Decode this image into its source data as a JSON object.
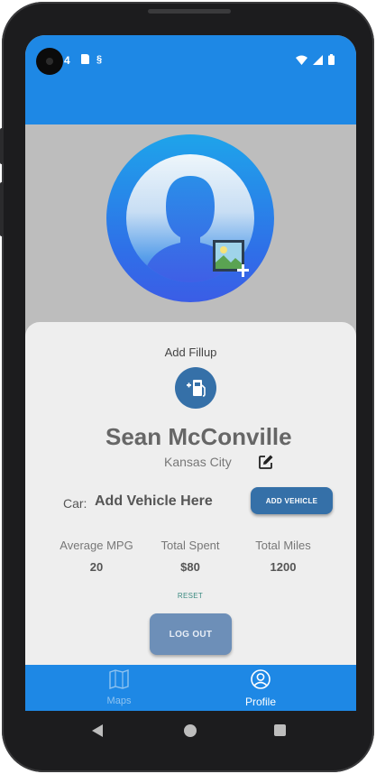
{
  "status_bar": {
    "time": "4",
    "left_icons": [
      "sd-card-icon",
      "sync-icon"
    ],
    "right_icons": [
      "wifi-icon",
      "signal-icon",
      "battery-icon"
    ]
  },
  "profile": {
    "avatar_icon": "person-icon",
    "add_photo_icon": "add-photo-icon",
    "fillup_label": "Add Fillup",
    "fillup_icon": "fuel-pump-icon",
    "name": "Sean McConville",
    "city": "Kansas City",
    "edit_icon": "edit-icon"
  },
  "vehicle": {
    "car_label": "Car:",
    "car_value": "Add Vehicle Here",
    "add_vehicle_label": "ADD VEHICLE"
  },
  "stats": [
    {
      "label": "Average MPG",
      "value": "20"
    },
    {
      "label": "Total Spent",
      "value": "$80"
    },
    {
      "label": "Total Miles",
      "value": "1200"
    }
  ],
  "actions": {
    "reset_label": "RESET",
    "logout_label": "LOG OUT"
  },
  "bottom_nav": {
    "items": [
      {
        "label": "Maps",
        "icon": "map-icon",
        "active": false
      },
      {
        "label": "Profile",
        "icon": "account-circle-icon",
        "active": true
      }
    ]
  },
  "colors": {
    "app_bar": "#1e88e5",
    "primary_button": "#3570a8",
    "logout_button": "#6d8fb8",
    "card_background": "#eeeeee",
    "screen_background": "#bdbdbd",
    "reset_link": "#3a8a80"
  }
}
